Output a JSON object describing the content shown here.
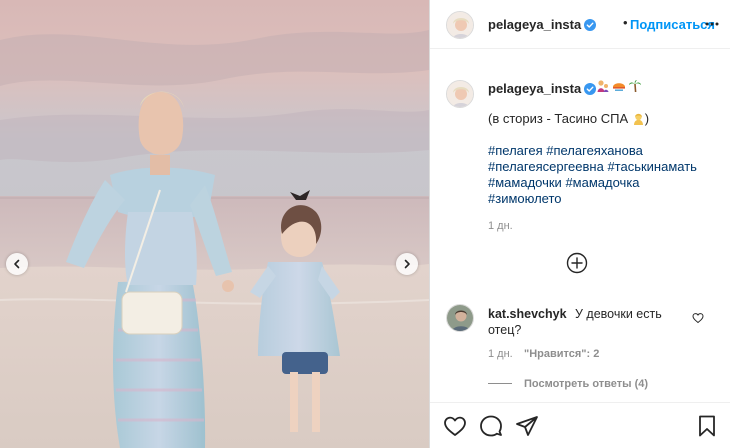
{
  "photo": {
    "description_icon": "photo",
    "nav_prev_icon": "chevron-left-icon",
    "nav_next_icon": "chevron-right-icon"
  },
  "header": {
    "username": "pelageya_insta",
    "dot": "•",
    "follow_label": "Подписаться"
  },
  "caption": {
    "username": "pelageya_insta",
    "line1": "(в сториз - Тасино СПА",
    "line1_end": ")",
    "hashtags": [
      [
        "#пелагея",
        "#пелагеяханова"
      ],
      [
        "#пелагеясергеевна",
        "#таськинамать"
      ],
      [
        "#мамадочки",
        "#мамадочка"
      ],
      [
        "#зимоюлето"
      ]
    ],
    "time": "1 дн."
  },
  "comment": {
    "username": "kat.shevchyk",
    "text_line1": "У девочки есть",
    "text_line2": "отец?",
    "time": "1 дн.",
    "likes": "\"Нравится\": 2",
    "view_replies": "Посмотреть ответы (4)"
  },
  "colors": {
    "link_blue": "#0095f6",
    "hashtag_blue": "#00376b",
    "muted": "#8e8e8e",
    "text": "#262626"
  }
}
